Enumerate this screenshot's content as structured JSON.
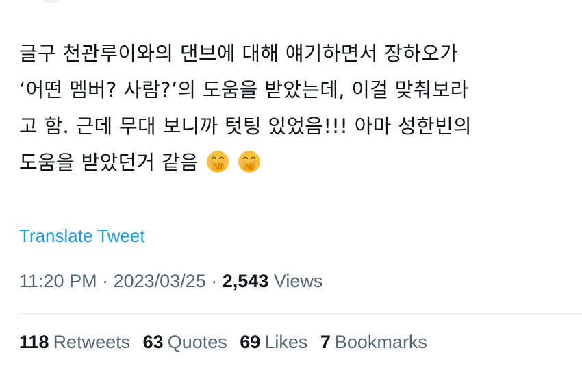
{
  "tweet": {
    "text_lines": [
      "글구 천관루이와의 댄브에 대해 얘기하면서 장하오가",
      "‘어떤 멤버? 사람?’의 도움을 받았는데, 이걸 맞춰보라",
      "고 함. 근데 무대 보니까 텃팅 있었음!!! 아마 성한빈의",
      "도움을 받았던거 같음"
    ],
    "emojis": [
      "face-with-hand-over-mouth-icon",
      "face-with-hand-over-mouth-icon"
    ],
    "translate_label": "Translate Tweet"
  },
  "meta": {
    "time": "11:20 PM",
    "separator": "·",
    "date": "2023/03/25",
    "views_count": "2,543",
    "views_label": "Views"
  },
  "stats": {
    "retweets_count": "118",
    "retweets_label": "Retweets",
    "quotes_count": "63",
    "quotes_label": "Quotes",
    "likes_count": "69",
    "likes_label": "Likes",
    "bookmarks_count": "7",
    "bookmarks_label": "Bookmarks"
  },
  "colors": {
    "text": "#0f1419",
    "secondary": "#536471",
    "link": "#1d9bf0",
    "divider": "#e8ecef",
    "emoji_face": "#f6c13d",
    "emoji_hand": "#f2a81c"
  }
}
